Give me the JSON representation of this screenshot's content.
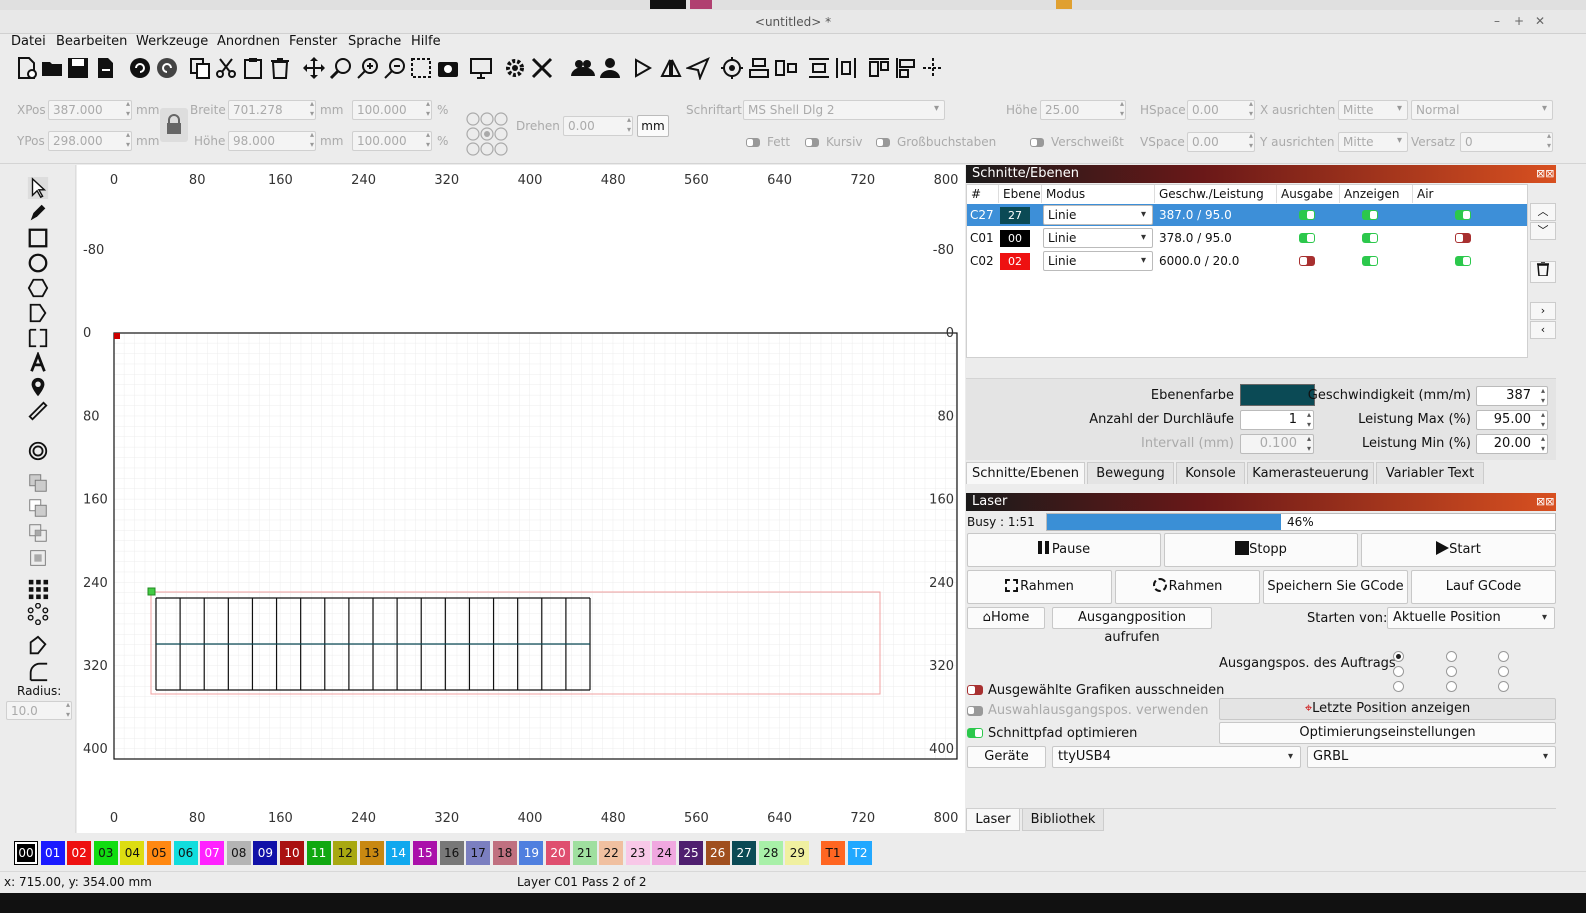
{
  "window": {
    "title": "<untitled> *"
  },
  "menu": [
    "Datei",
    "Bearbeiten",
    "Werkzeuge",
    "Anordnen",
    "Fenster",
    "Sprache",
    "Hilfe"
  ],
  "props": {
    "xpos_label": "XPos",
    "xpos": "387.000",
    "ypos_label": "YPos",
    "ypos": "298.000",
    "unit": "mm",
    "breite_label": "Breite",
    "breite": "701.278",
    "hoehe_label": "Höhe",
    "hoehe": "98.000",
    "pct1": "100.000",
    "pct2": "100.000",
    "pct": "%",
    "drehen_label": "Drehen",
    "drehen": "0.00",
    "mm_btn": "mm",
    "schriftart_label": "Schriftart",
    "schriftart": "MS Shell Dlg 2",
    "font_hoehe_label": "Höhe",
    "font_hoehe": "25.00",
    "hspace_label": "HSpace",
    "hspace": "0.00",
    "vspace_label": "VSpace",
    "vspace": "0.00",
    "xausr_label": "X ausrichten",
    "xausr": "Mitte",
    "yausr_label": "Y ausrichten",
    "yausr": "Mitte",
    "normal": "Normal",
    "versatz_label": "Versatz",
    "versatz": "0",
    "fett": "Fett",
    "kursiv": "Kursiv",
    "gross": "Großbuchstaben",
    "verschweisst": "Verschweißt"
  },
  "left": {
    "radius_label": "Radius:",
    "radius": "10.0"
  },
  "canvas": {
    "top_ticks": [
      "0",
      "80",
      "160",
      "240",
      "320",
      "400",
      "480",
      "560",
      "640",
      "720",
      "800"
    ],
    "left_ticks": [
      "-80",
      "0",
      "80",
      "160",
      "240",
      "320",
      "400"
    ],
    "right_ticks": [
      "-80",
      "0",
      "80",
      "160",
      "240",
      "320",
      "400"
    ]
  },
  "layers": {
    "header": "Schnitte/Ebenen",
    "cols": [
      "#",
      "Ebene",
      "Modus",
      "Geschw./Leistung",
      "Ausgabe",
      "Anzeigen",
      "Air"
    ],
    "rows": [
      {
        "id": "C27",
        "layer": "27",
        "color": "#0b4a55",
        "mode": "Linie",
        "speed": "387.0 / 95.0",
        "out": true,
        "show": true,
        "air": true
      },
      {
        "id": "C01",
        "layer": "00",
        "color": "#000000",
        "mode": "Linie",
        "speed": "378.0 / 95.0",
        "out": true,
        "show": true,
        "air": false
      },
      {
        "id": "C02",
        "layer": "02",
        "color": "#ee1111",
        "mode": "Linie",
        "speed": "6000.0 / 20.0",
        "out": false,
        "show": true,
        "air": true
      }
    ],
    "ebenenfarbe_label": "Ebenenfarbe",
    "ebenenfarbe": "#0b4a55",
    "geschw_label": "Geschwindigkeit (mm/m)",
    "geschw": "387",
    "durchl_label": "Anzahl der Durchläufe",
    "durchl": "1",
    "lmax_label": "Leistung Max (%)",
    "lmax": "95.00",
    "intervall_label": "Intervall (mm)",
    "intervall": "0.100",
    "lmin_label": "Leistung Min (%)",
    "lmin": "20.00"
  },
  "tabs1": [
    "Schnitte/Ebenen",
    "Bewegung",
    "Konsole",
    "Kamerasteuerung",
    "Variabler Text"
  ],
  "laser": {
    "header": "Laser",
    "busy": "Busy : 1:51",
    "progress": 46,
    "progress_text": "46%",
    "pause": "Pause",
    "stopp": "Stopp",
    "start": "Start",
    "rahmen1": "Rahmen",
    "rahmen2": "Rahmen",
    "speichern": "Speichern Sie GCode",
    "lauf": "Lauf GCode",
    "home": "Home",
    "ausgangs": "Ausgangposition aufrufen",
    "starten_label": "Starten von:",
    "starten": "Aktuelle Position",
    "auftrag_label": "Ausgangspos. des Auftrags",
    "cut_sel": "Ausgewählte Grafiken ausschneiden",
    "use_sel": "Auswahlausgangspos. verwenden",
    "optimize": "Schnittpfad optimieren",
    "letzte": "Letzte Position anzeigen",
    "optimier": "Optimierungseinstellungen",
    "geraete": "Geräte",
    "port": "ttyUSB4",
    "firmware": "GRBL"
  },
  "tabs2": [
    "Laser",
    "Bibliothek"
  ],
  "palette": [
    {
      "t": "00",
      "c": "#000000",
      "f": "#ffffff"
    },
    {
      "t": "01",
      "c": "#1a1aff",
      "f": "#ffffff"
    },
    {
      "t": "02",
      "c": "#ee1111",
      "f": "#ffffff"
    },
    {
      "t": "03",
      "c": "#11dd11",
      "f": "#111111"
    },
    {
      "t": "04",
      "c": "#dddd11",
      "f": "#111111"
    },
    {
      "t": "05",
      "c": "#ff8811",
      "f": "#111111"
    },
    {
      "t": "06",
      "c": "#11dddd",
      "f": "#111111"
    },
    {
      "t": "07",
      "c": "#ff22ff",
      "f": "#ffffff"
    },
    {
      "t": "08",
      "c": "#b4b4b4",
      "f": "#111111"
    },
    {
      "t": "09",
      "c": "#1111a8",
      "f": "#ffffff"
    },
    {
      "t": "10",
      "c": "#aa1111",
      "f": "#ffffff"
    },
    {
      "t": "11",
      "c": "#11a811",
      "f": "#ffffff"
    },
    {
      "t": "12",
      "c": "#a8a811",
      "f": "#111111"
    },
    {
      "t": "13",
      "c": "#c88811",
      "f": "#111111"
    },
    {
      "t": "14",
      "c": "#11a8ee",
      "f": "#ffffff"
    },
    {
      "t": "15",
      "c": "#aa11aa",
      "f": "#ffffff"
    },
    {
      "t": "16",
      "c": "#787878",
      "f": "#111111"
    },
    {
      "t": "17",
      "c": "#7b7fc0",
      "f": "#111111"
    },
    {
      "t": "18",
      "c": "#c07080",
      "f": "#111111"
    },
    {
      "t": "19",
      "c": "#4f7fdf",
      "f": "#ffffff"
    },
    {
      "t": "20",
      "c": "#df4f6f",
      "f": "#ffffff"
    },
    {
      "t": "21",
      "c": "#9fdf9f",
      "f": "#111111"
    },
    {
      "t": "22",
      "c": "#f0c0a0",
      "f": "#111111"
    },
    {
      "t": "23",
      "c": "#f8c8e8",
      "f": "#111111"
    },
    {
      "t": "24",
      "c": "#f0a8e0",
      "f": "#111111"
    },
    {
      "t": "25",
      "c": "#4f1f6f",
      "f": "#ffffff"
    },
    {
      "t": "26",
      "c": "#a04f1f",
      "f": "#ffffff"
    },
    {
      "t": "27",
      "c": "#0b4a55",
      "f": "#ffffff"
    },
    {
      "t": "28",
      "c": "#a8f0a8",
      "f": "#111111"
    },
    {
      "t": "29",
      "c": "#f0f0a0",
      "f": "#111111"
    },
    {
      "t": "T1",
      "c": "#ff6622",
      "f": "#111111"
    },
    {
      "t": "T2",
      "c": "#22a8ff",
      "f": "#ffffff"
    }
  ],
  "status": {
    "coords": "x: 715.00, y: 354.00 mm",
    "layer": "Layer C01 Pass 2 of 2"
  }
}
